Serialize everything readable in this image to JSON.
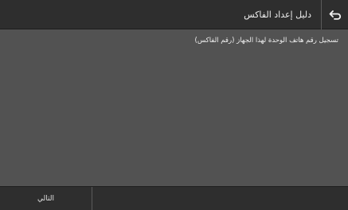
{
  "header": {
    "title": "دليل إعداد الفاكس",
    "back_icon": "back-arrow-icon"
  },
  "main": {
    "message": "تسجيل رقم هاتف الوحدة لهذا الجهاز (رقم الفاكس)"
  },
  "footer": {
    "next_label": "التالي"
  },
  "colors": {
    "header_bg": "#2e2e2e",
    "content_bg": "#525252",
    "footer_bg": "#2e2e2e",
    "text": "#ededed"
  }
}
